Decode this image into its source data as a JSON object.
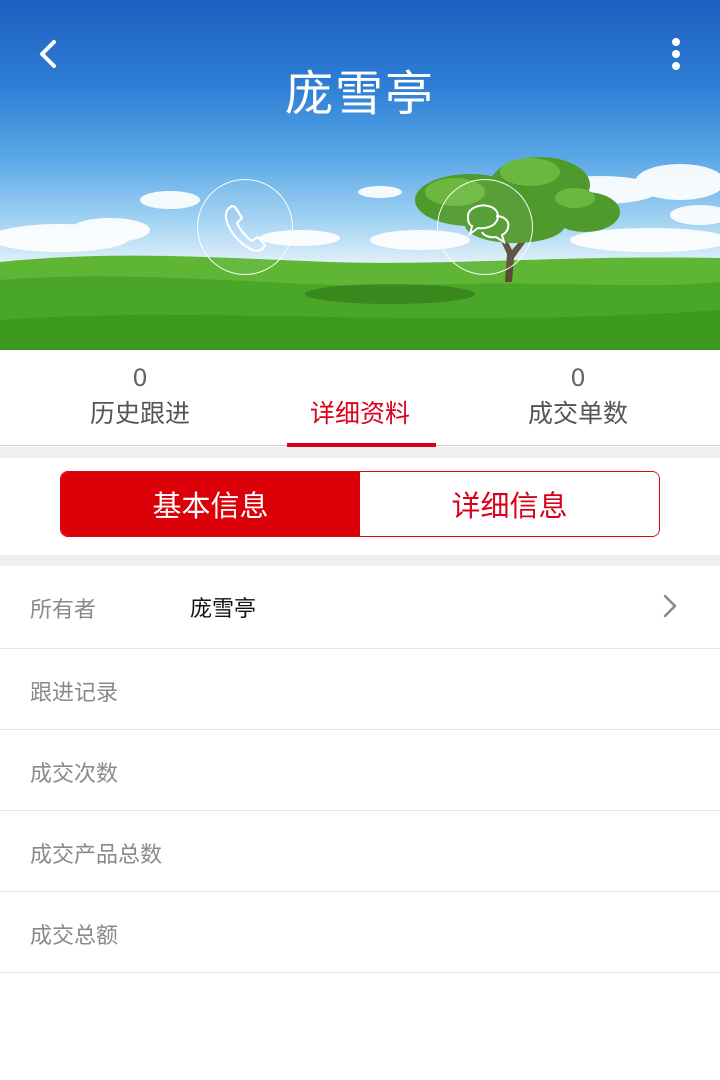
{
  "header": {
    "contact_name": "庞雪亭",
    "back_icon": "chevron-left-icon",
    "more_icon": "more-vertical-icon"
  },
  "actions": {
    "call_icon": "phone-icon",
    "chat_icon": "chat-bubbles-icon"
  },
  "stats": {
    "tabs": [
      {
        "count": "0",
        "label": "历史跟进"
      },
      {
        "count": "",
        "label": "详细资料"
      },
      {
        "count": "0",
        "label": "成交单数"
      }
    ],
    "active_tab": 1
  },
  "segments": {
    "basic": "基本信息",
    "detail": "详细信息",
    "active": "basic"
  },
  "fields": [
    {
      "label": "所有者",
      "value": "庞雪亭"
    },
    {
      "label": "跟进记录",
      "value": ""
    },
    {
      "label": "成交次数",
      "value": ""
    },
    {
      "label": "成交产品总数",
      "value": ""
    },
    {
      "label": "成交总额",
      "value": ""
    }
  ],
  "colors": {
    "accent": "#d9001b",
    "segment_active_bg": "#dc0009",
    "label_gray": "#8a8a8a",
    "divider": "#e6e6e6"
  }
}
